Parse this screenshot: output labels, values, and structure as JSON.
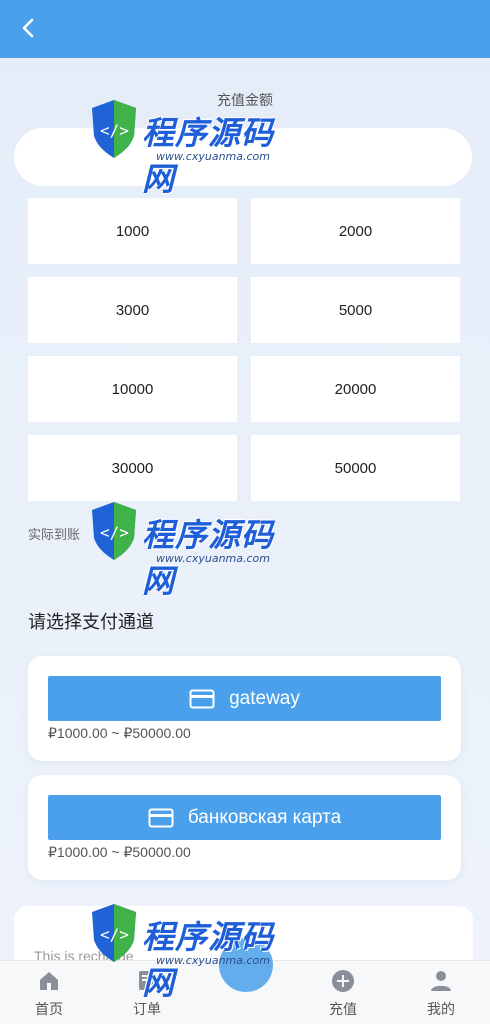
{
  "header": {
    "back_icon": "chevron-left-icon"
  },
  "recharge": {
    "amount_label": "充值金额",
    "amount_value": "",
    "options": [
      "1000",
      "2000",
      "3000",
      "5000",
      "10000",
      "20000",
      "30000",
      "50000"
    ],
    "actual_label": "实际到账"
  },
  "channels": {
    "title": "请选择支付通道",
    "items": [
      {
        "label": "gateway",
        "range": "₽1000.00 ~ ₽50000.00",
        "icon": "credit-card-icon"
      },
      {
        "label": "банковская карта",
        "range": "₽1000.00 ~ ₽50000.00",
        "icon": "credit-card-icon"
      }
    ]
  },
  "notice": {
    "text": "This is recharge"
  },
  "nav": {
    "items": [
      {
        "label": "首页",
        "icon": "home-icon"
      },
      {
        "label": "订单",
        "icon": "order-icon"
      },
      {
        "label": "",
        "icon": "center-bubble"
      },
      {
        "label": "充值",
        "icon": "plus-circle-icon"
      },
      {
        "label": "我的",
        "icon": "user-icon"
      }
    ]
  },
  "watermark": {
    "brand": "程序源码网",
    "url": "www.cxyuanma.com"
  },
  "colors": {
    "primary": "#4aa0ea",
    "background": "#e9f0fa"
  }
}
